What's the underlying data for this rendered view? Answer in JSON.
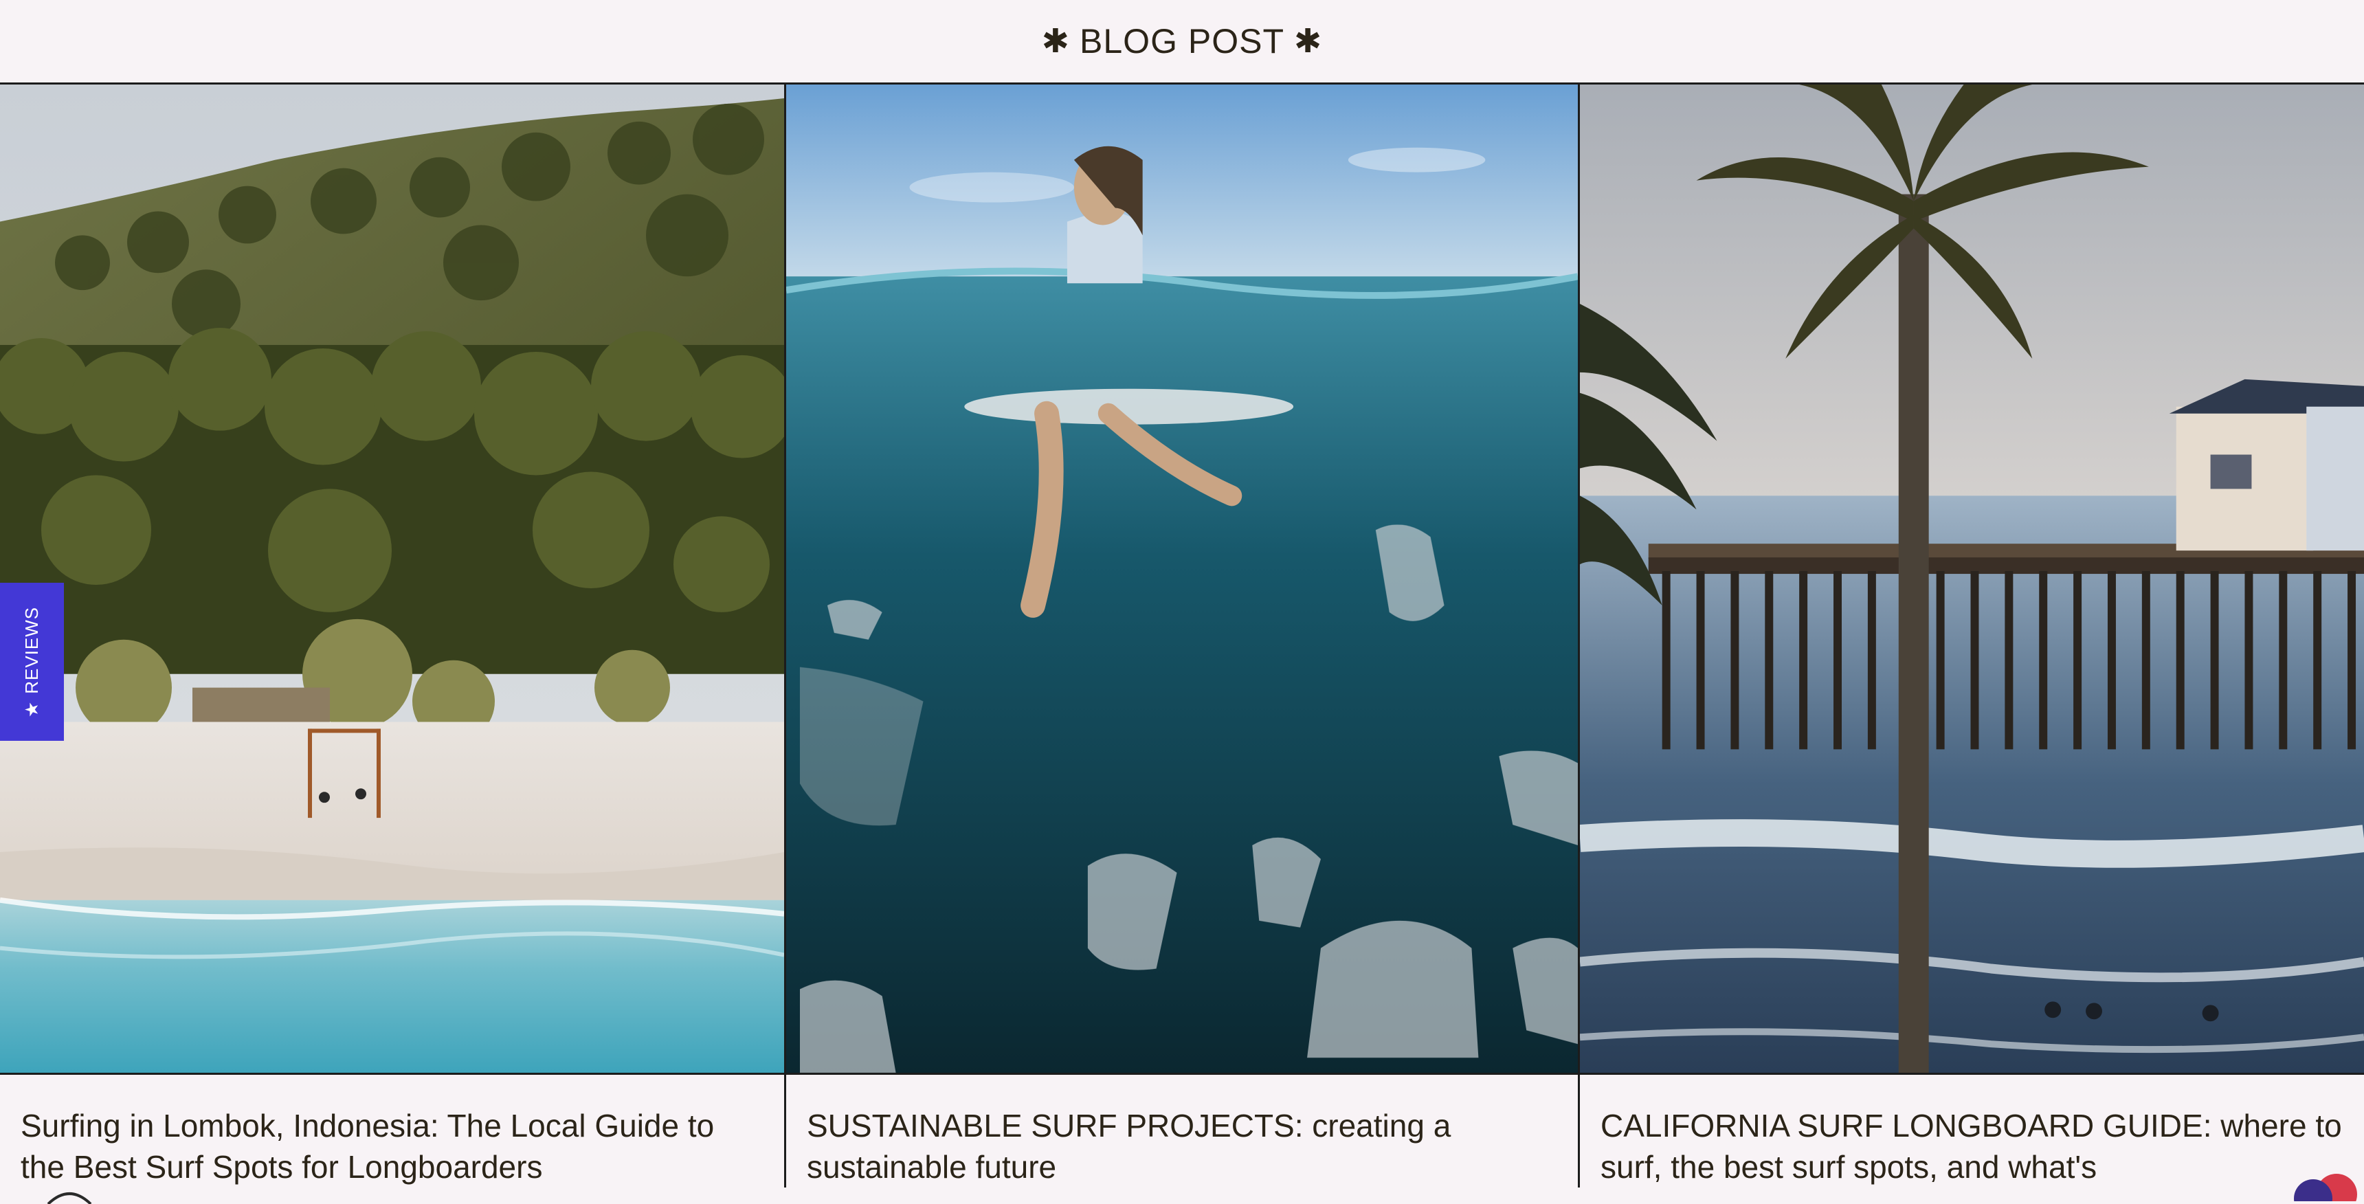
{
  "header": {
    "star_left": "✱",
    "title": "BLOG POST",
    "star_right": "✱"
  },
  "reviews_tab": {
    "icon": "star-icon",
    "icon_glyph": "★",
    "label": "REVIEWS"
  },
  "posts": [
    {
      "image": "lombok-beach-photo",
      "title": "Surfing in Lombok, Indonesia: The Local Guide to the Best Surf Spots for Longboarders"
    },
    {
      "image": "underwater-plastic-surfer-photo",
      "title": "SUSTAINABLE SURF PROJECTS: creating a sustainable future"
    },
    {
      "image": "california-pier-palm-photo",
      "title": "CALIFORNIA SURF LONGBOARD GUIDE: where to surf, the best surf spots, and what's"
    }
  ],
  "colors": {
    "background": "#f8f3f6",
    "border": "#1c1c1c",
    "text": "#2b2418",
    "reviews_tab": "#4338d6"
  }
}
